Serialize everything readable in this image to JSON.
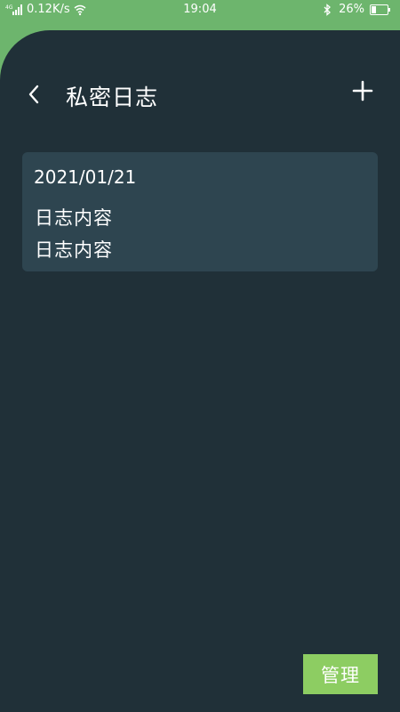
{
  "status_bar": {
    "network_speed": "0.12K/s",
    "time": "19:04",
    "battery": "26%"
  },
  "header": {
    "title": "私密日志"
  },
  "entries": [
    {
      "date": "2021/01/21",
      "lines": [
        "日志内容",
        "日志内容"
      ]
    }
  ],
  "footer": {
    "manage_label": "管理"
  },
  "colors": {
    "status_bar_bg": "#6db56d",
    "panel_bg": "#203038",
    "card_bg": "#2e4550",
    "manage_button_bg": "#8dcd62"
  },
  "icons": {
    "signal": "signal-icon",
    "wifi": "wifi-icon",
    "bluetooth": "bluetooth-icon",
    "battery": "battery-icon",
    "back": "back-arrow-icon",
    "add": "plus-icon"
  }
}
